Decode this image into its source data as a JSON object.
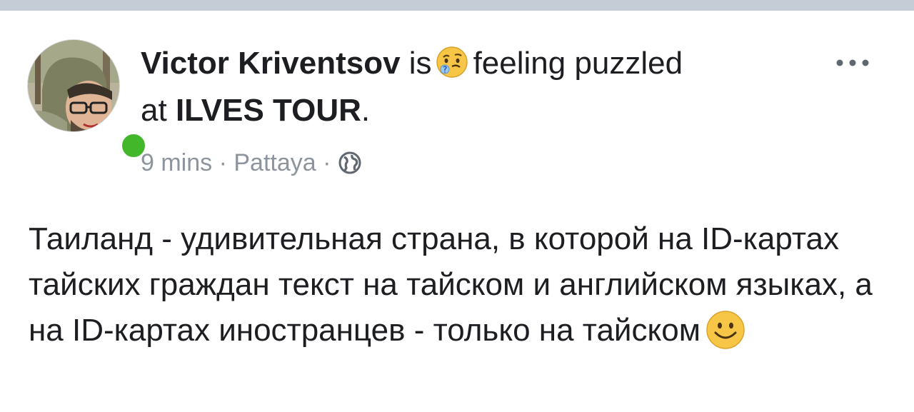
{
  "post": {
    "author": "Victor Kriventsov",
    "is_text": "is",
    "feeling_text": "feeling puzzled",
    "at_text": "at",
    "location_name": "ILVES TOUR",
    "location_suffix": ".",
    "time": "9 mins",
    "separator": "·",
    "city": "Pattaya",
    "privacy_icon": "globe-icon",
    "feeling_icon": "puzzled-face-emoji",
    "more_icon": "more-dots-icon",
    "online_status_color": "#42b72a",
    "body": "Таиланд - удивительная страна, в которой на ID-картах тайских граждан текст на тайском и английском языках, а на ID-картах иностранцев - только на тайском",
    "body_emoji": "smiling-face-emoji"
  }
}
